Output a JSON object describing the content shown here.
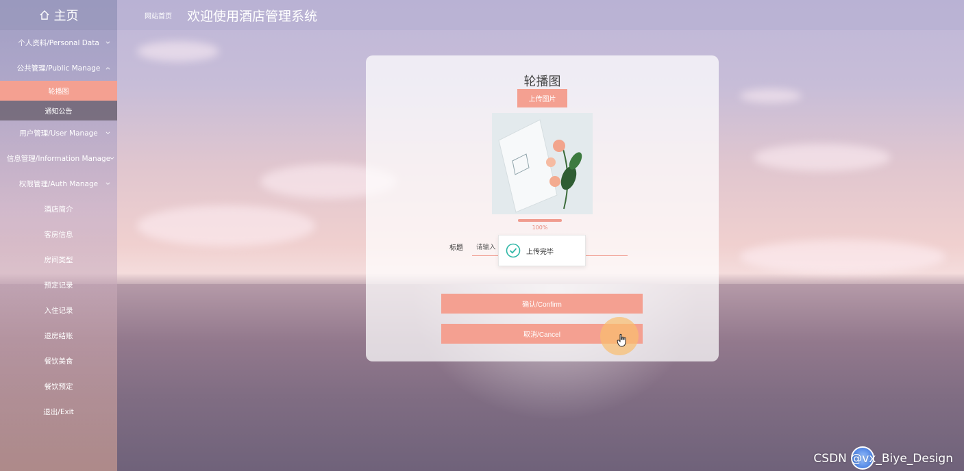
{
  "sidebar": {
    "brand": "主页",
    "items": [
      {
        "label": "个人资料/Personal Data",
        "chevron": "down"
      },
      {
        "label": "公共管理/Public Manage",
        "chevron": "up"
      },
      {
        "label": "用户管理/User Manage",
        "chevron": "down"
      },
      {
        "label": "信息管理/Information Manage",
        "chevron": "down"
      },
      {
        "label": "权限管理/Auth Manage",
        "chevron": "down"
      },
      {
        "label": "酒店简介"
      },
      {
        "label": "客房信息"
      },
      {
        "label": "房间类型"
      },
      {
        "label": "预定记录"
      },
      {
        "label": "入住记录"
      },
      {
        "label": "退房结账"
      },
      {
        "label": "餐饮美食"
      },
      {
        "label": "餐饮预定"
      },
      {
        "label": "退出/Exit"
      }
    ],
    "sub_items": [
      {
        "label": "轮播图",
        "active": true
      },
      {
        "label": "通知公告",
        "active": false
      }
    ]
  },
  "header": {
    "breadcrumb": "网站首页",
    "title": "欢迎使用酒店管理系统"
  },
  "dialog": {
    "title": "轮播图",
    "upload_label": "上传图片",
    "progress_value": 100,
    "progress_text": "100%",
    "field_label": "标题",
    "field_placeholder": "请输入",
    "toast_text": "上传完毕",
    "confirm_label": "确认/Confirm",
    "cancel_label": "取消/Cancel"
  },
  "watermark": "CSDN @vx_Biye_Design",
  "colors": {
    "accent": "#f4a091",
    "active_menu": "#f4a091"
  }
}
